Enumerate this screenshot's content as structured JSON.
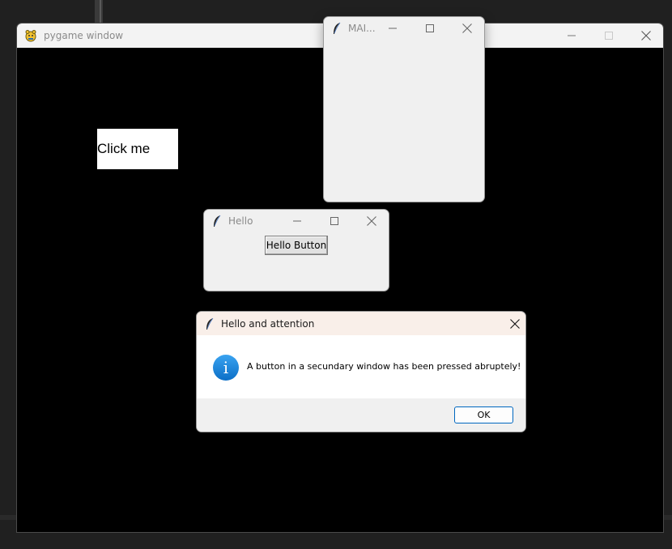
{
  "pygame_window": {
    "title": "pygame window",
    "click_button_label": "Click me"
  },
  "main_window": {
    "title": "MAI..."
  },
  "hello_window": {
    "title": "Hello",
    "button_label": "Hello Button"
  },
  "dialog": {
    "title": "Hello and attention",
    "icon": "info-icon",
    "icon_glyph": "i",
    "message": "A button in a secundary window has been pressed abruptely!",
    "ok_label": "OK"
  },
  "colors": {
    "pygame_background": "#000000",
    "tk_background": "#f0f0f0",
    "dialog_titlebar": "#f9efe9",
    "info_blue": "#1a86dd",
    "ok_border": "#0067c0"
  }
}
